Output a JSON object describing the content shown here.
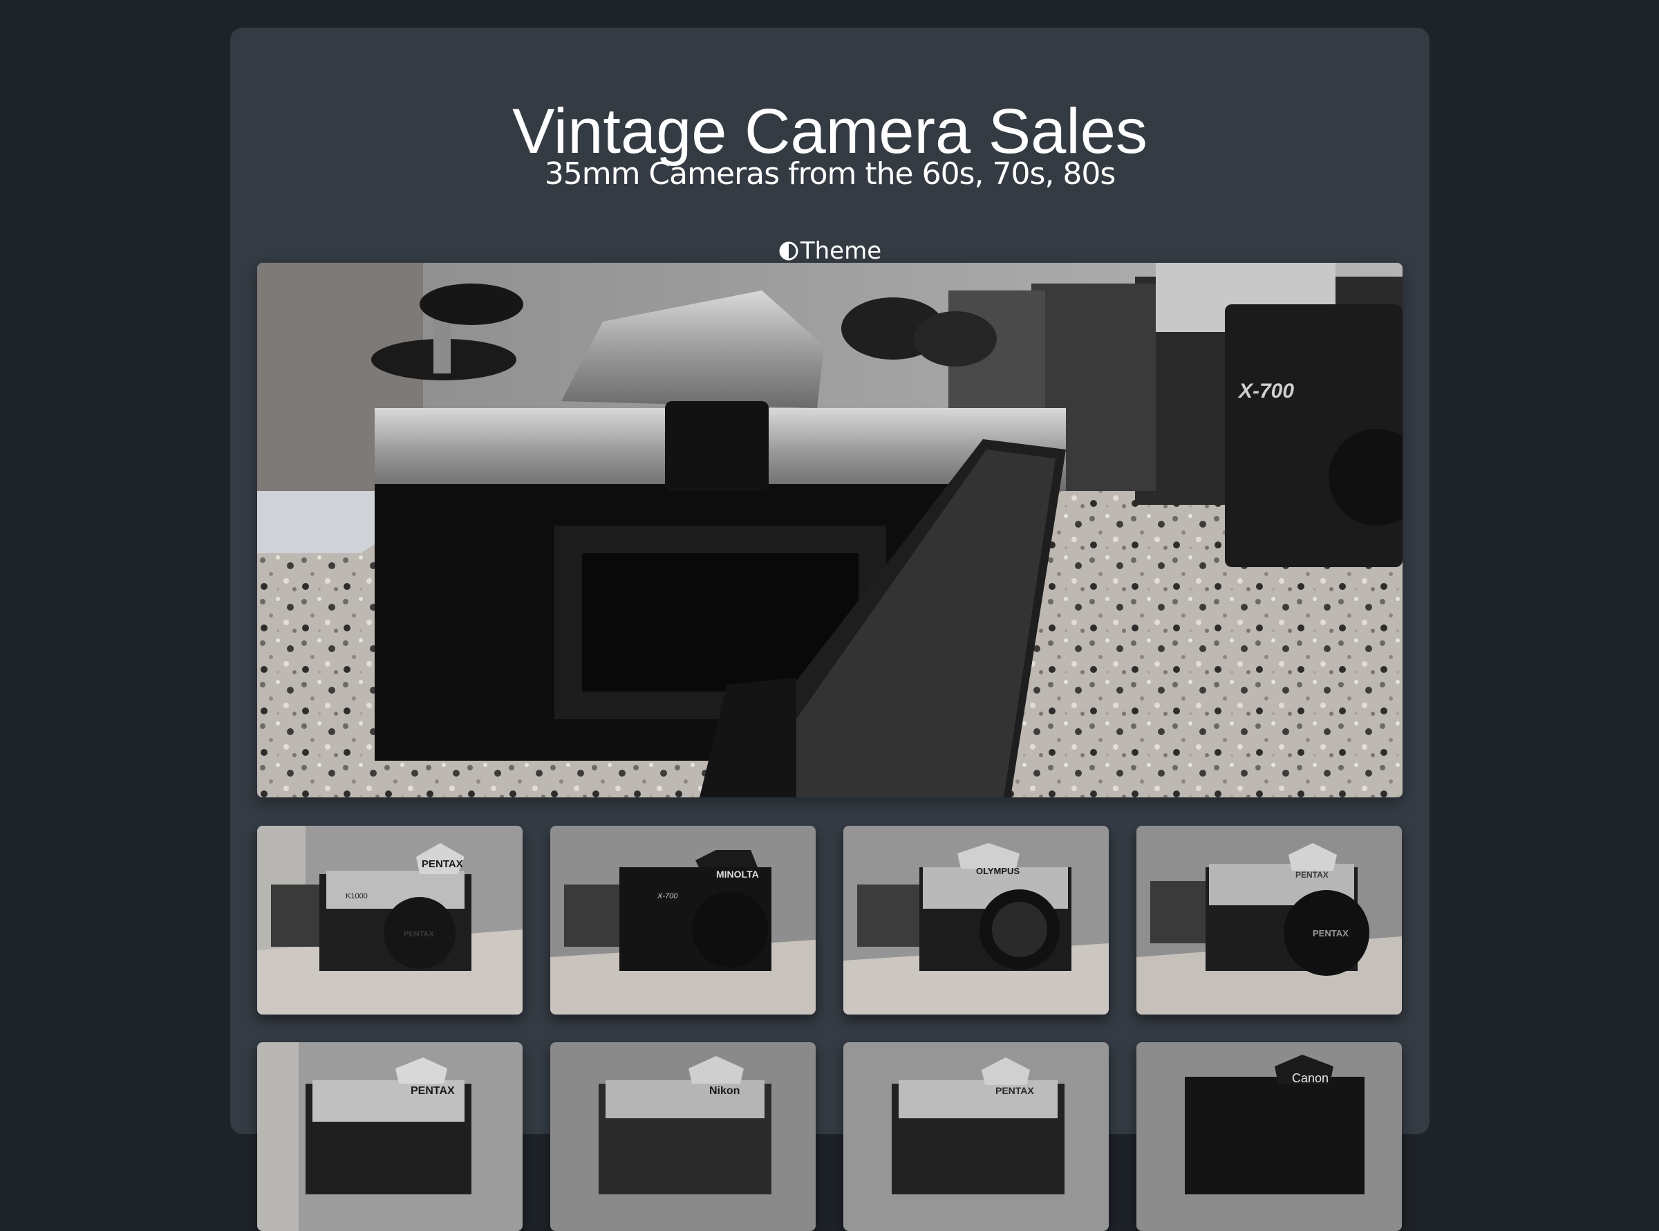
{
  "header": {
    "title": "Vintage Camera Sales",
    "subtitle": "35mm Cameras from the 60s, 70s, 80s",
    "theme_label": "Theme",
    "theme_icon": "half-circle-contrast-icon"
  },
  "hero": {
    "image": "camera-open-back-photo",
    "engravings": [
      "X-700"
    ]
  },
  "gallery": {
    "thumbnails": [
      {
        "brand": "PENTAX",
        "model": "K1000",
        "lens": "PENTAX"
      },
      {
        "brand": "MINOLTA",
        "model": "X-700",
        "lens": ""
      },
      {
        "brand": "OLYMPUS",
        "model": "",
        "lens": ""
      },
      {
        "brand": "PENTAX",
        "model": "",
        "lens": "PENTAX"
      },
      {
        "brand": "PENTAX",
        "model": "",
        "lens": ""
      },
      {
        "brand": "Nikon",
        "model": "",
        "lens": ""
      },
      {
        "brand": "PENTAX",
        "model": "",
        "lens": ""
      },
      {
        "brand": "Canon",
        "model": "",
        "lens": ""
      }
    ]
  },
  "colors": {
    "page_bg": "#1e2328",
    "card_bg": "#343b43",
    "text": "#ffffff"
  }
}
